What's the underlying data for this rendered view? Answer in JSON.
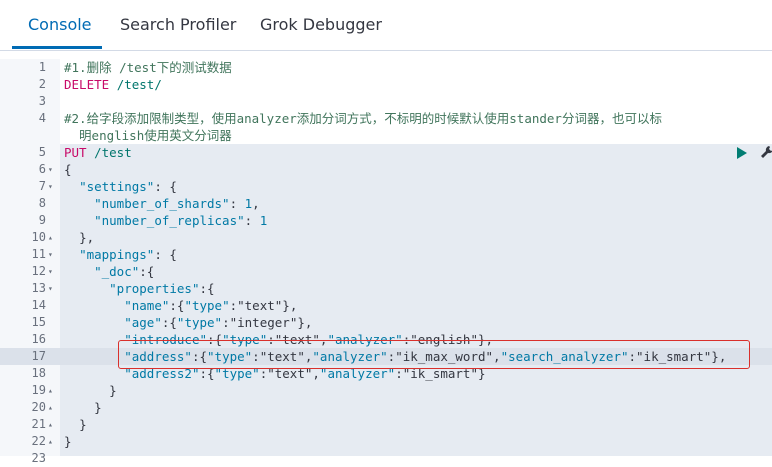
{
  "tabs": [
    {
      "label": "Console",
      "active": true
    },
    {
      "label": "Search Profiler",
      "active": false
    },
    {
      "label": "Grok Debugger",
      "active": false
    }
  ],
  "editor": {
    "lines": [
      {
        "n": "1",
        "fold": "",
        "code": "#1.删除 /test下的测试数据"
      },
      {
        "n": "2",
        "fold": "",
        "code": "DELETE /test/"
      },
      {
        "n": "3",
        "fold": "",
        "code": ""
      },
      {
        "n": "4",
        "fold": "",
        "code": "#2.给字段添加限制类型，使用analyzer添加分词方式，不标明的时候默认使用stander分词器，也可以标"
      },
      {
        "n": "",
        "fold": "",
        "code": "  明english使用英文分词器"
      },
      {
        "n": "5",
        "fold": "",
        "code": "PUT /test"
      },
      {
        "n": "6",
        "fold": "▾",
        "code": "{"
      },
      {
        "n": "7",
        "fold": "▾",
        "code": "  \"settings\": {"
      },
      {
        "n": "8",
        "fold": "",
        "code": "    \"number_of_shards\": 1,"
      },
      {
        "n": "9",
        "fold": "",
        "code": "    \"number_of_replicas\": 1"
      },
      {
        "n": "10",
        "fold": "▴",
        "code": "  },"
      },
      {
        "n": "11",
        "fold": "▾",
        "code": "  \"mappings\": {"
      },
      {
        "n": "12",
        "fold": "▾",
        "code": "    \"_doc\":{"
      },
      {
        "n": "13",
        "fold": "▾",
        "code": "      \"properties\":{"
      },
      {
        "n": "14",
        "fold": "",
        "code": "        \"name\":{\"type\":\"text\"},"
      },
      {
        "n": "15",
        "fold": "",
        "code": "        \"age\":{\"type\":\"integer\"},"
      },
      {
        "n": "16",
        "fold": "",
        "code": "        \"introduce\":{\"type\":\"text\",\"analyzer\":\"english\"},"
      },
      {
        "n": "17",
        "fold": "",
        "code": "        \"address\":{\"type\":\"text\",\"analyzer\":\"ik_max_word\",\"search_analyzer\":\"ik_smart\"},"
      },
      {
        "n": "18",
        "fold": "",
        "code": "        \"address2\":{\"type\":\"text\",\"analyzer\":\"ik_smart\"}"
      },
      {
        "n": "19",
        "fold": "▴",
        "code": "      }"
      },
      {
        "n": "20",
        "fold": "▴",
        "code": "    }"
      },
      {
        "n": "21",
        "fold": "▴",
        "code": "  }"
      },
      {
        "n": "22",
        "fold": "▴",
        "code": "}"
      },
      {
        "n": "23",
        "fold": "",
        "code": ""
      }
    ]
  },
  "icons": {
    "run": "play-icon",
    "settings": "wrench-icon"
  },
  "colors": {
    "accent": "#006bb4",
    "highlight_border": "#d9302c",
    "run": "#017d73"
  }
}
